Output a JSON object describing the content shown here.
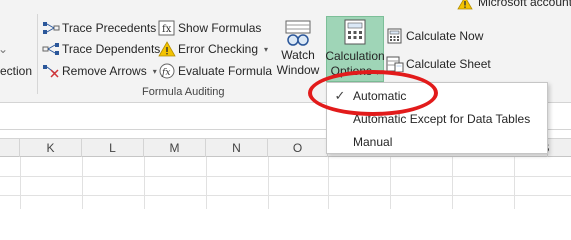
{
  "account": {
    "label": "Microsoft account"
  },
  "left_stub": {
    "label": "ection"
  },
  "formula_auditing": {
    "group_label": "Formula Auditing",
    "trace_precedents": "Trace Precedents",
    "trace_dependents": "Trace Dependents",
    "remove_arrows": "Remove Arrows",
    "show_formulas": "Show Formulas",
    "error_checking": "Error Checking",
    "evaluate_formula": "Evaluate Formula"
  },
  "watch_window": {
    "line1": "Watch",
    "line2": "Window"
  },
  "calculation": {
    "options_line1": "Calculation",
    "options_line2": "Options",
    "calculate_now": "Calculate Now",
    "calculate_sheet": "Calculate Sheet"
  },
  "menu": {
    "items": [
      {
        "label": "Automatic",
        "checked": true
      },
      {
        "label": "Automatic Except for Data Tables",
        "checked": false
      },
      {
        "label": "Manual",
        "checked": false
      }
    ]
  },
  "columns": [
    "K",
    "L",
    "M",
    "N",
    "O",
    "S"
  ],
  "colors": {
    "calc_button_bg": "#9fd5b7",
    "highlight_oval": "#e21b1b"
  }
}
